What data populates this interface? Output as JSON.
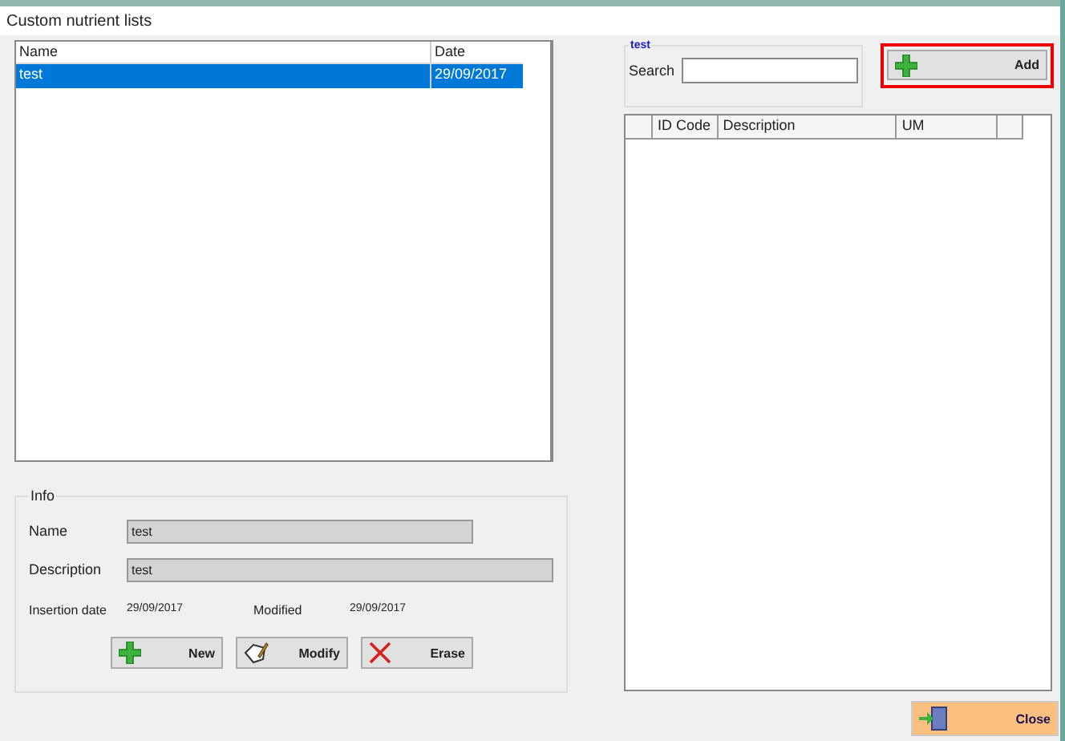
{
  "window": {
    "title": "Custom nutrient lists"
  },
  "lists_table": {
    "columns": [
      "Name",
      "Date"
    ],
    "rows": [
      {
        "name": "test",
        "date": "29/09/2017",
        "selected": true
      }
    ]
  },
  "info": {
    "legend": "Info",
    "name_label": "Name",
    "name_value": "test",
    "description_label": "Description",
    "description_value": "test",
    "insertion_label": "Insertion date",
    "insertion_value": "29/09/2017",
    "modified_label": "Modified",
    "modified_value": "29/09/2017",
    "buttons": [
      {
        "label": "New",
        "kind": "plus"
      },
      {
        "label": "Modify",
        "kind": "edit"
      },
      {
        "label": "Erase",
        "kind": "cross"
      }
    ]
  },
  "search": {
    "legend": "test",
    "label": "Search"
  },
  "add_button": {
    "label": "Add",
    "highlighted": true
  },
  "items_table": {
    "columns": [
      "ID Code",
      "Description",
      "UM"
    ]
  },
  "close_button": {
    "label": "Close"
  }
}
